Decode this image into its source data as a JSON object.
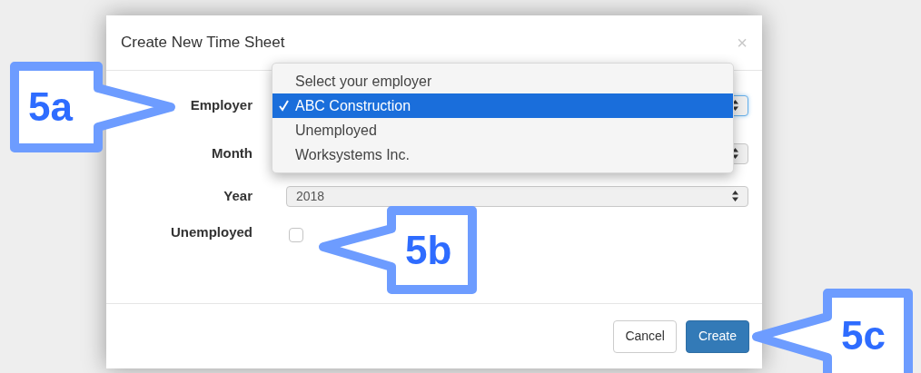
{
  "dialog": {
    "title": "Create New Time Sheet",
    "close": "×"
  },
  "fields": [
    {
      "kind": "select",
      "label": "Employer",
      "focused": true
    },
    {
      "kind": "select",
      "label": "Month",
      "focused": false
    },
    {
      "kind": "select",
      "label": "Year",
      "value": "2018",
      "focused": false
    },
    {
      "kind": "checkbox",
      "label": "Unemployed",
      "checked": false
    }
  ],
  "dropdown": {
    "options": [
      {
        "label": "Select your employer",
        "selected": false
      },
      {
        "label": "ABC Construction",
        "selected": true
      },
      {
        "label": "Unemployed",
        "selected": false
      },
      {
        "label": "Worksystems Inc.",
        "selected": false
      }
    ]
  },
  "buttons": [
    {
      "label": "Cancel",
      "kind": "default"
    },
    {
      "label": "Create",
      "kind": "primary"
    }
  ],
  "callouts": [
    {
      "label": "5a"
    },
    {
      "label": "5b"
    },
    {
      "label": "5c"
    }
  ]
}
